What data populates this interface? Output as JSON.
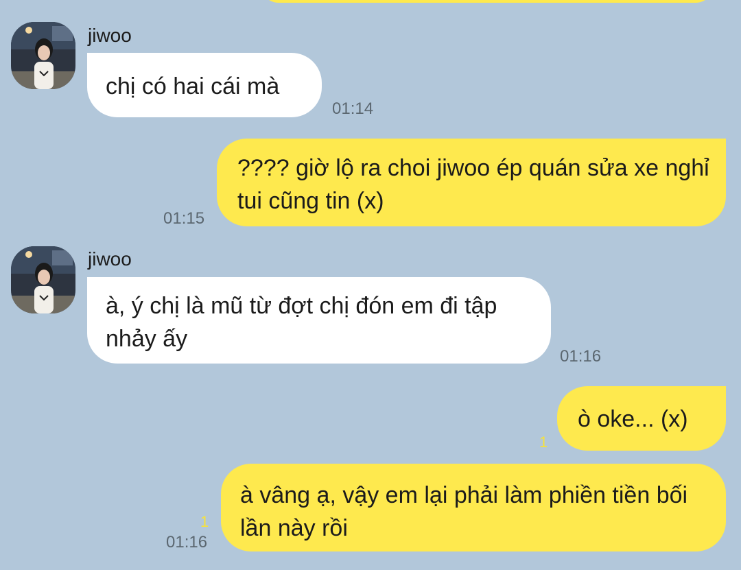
{
  "chat": {
    "messages": [
      {
        "type": "received",
        "sender": "jiwoo",
        "text": "chị có hai cái mà",
        "time": "01:14"
      },
      {
        "type": "sent",
        "text": "???? giờ lộ ra choi jiwoo ép quán sửa xe nghỉ tui cũng tin (x)",
        "time": "01:15"
      },
      {
        "type": "received",
        "sender": "jiwoo",
        "text": "à, ý chị là mũ từ đợt chị đón em đi tập nhảy ấy",
        "time": "01:16"
      },
      {
        "type": "sent",
        "text": "ò oke... (x)",
        "unread": "1"
      },
      {
        "type": "sent",
        "text": "à vâng ạ, vậy em lại phải làm phiền tiền bối lần này rồi",
        "unread": "1",
        "time": "01:16"
      }
    ]
  },
  "colors": {
    "background": "#b2c7da",
    "sent_bubble": "#fee94e",
    "received_bubble": "#ffffff",
    "unread": "#f7e23a"
  },
  "icons": {
    "avatar": "profile-photo"
  }
}
